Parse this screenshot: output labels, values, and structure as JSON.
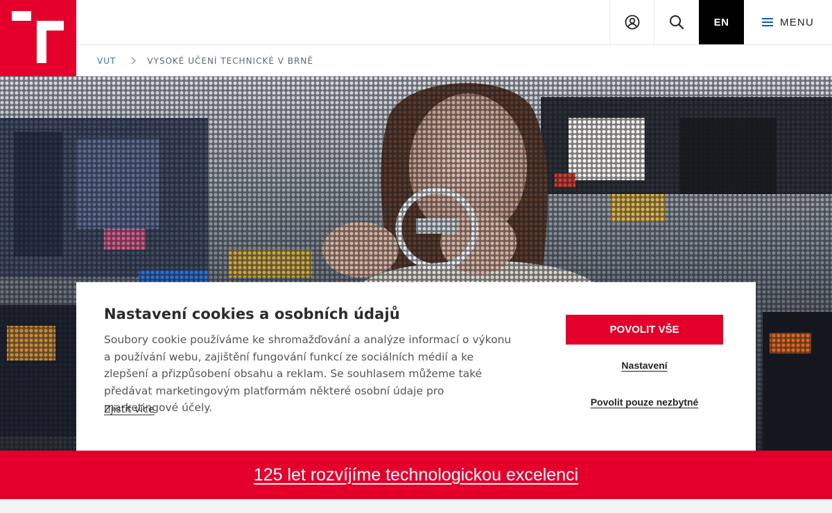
{
  "header": {
    "logo_icon": "vut-logo",
    "user_icon": "user-icon",
    "search_icon": "search-icon",
    "language_label": "EN",
    "menu_label": "MENU"
  },
  "breadcrumb": {
    "home": "VUT",
    "current": "VYSOKÉ UČENÍ TECHNICKÉ V BRNĚ"
  },
  "cookie_banner": {
    "title": "Nastavení cookies a osobních údajů",
    "text": "Soubory cookie používáme ke shromažďování a analýze informací o výkonu a používání webu, zajištění fungování funkcí ze sociálních médií a ke zlepšení a přizpůsobení obsahu a reklam. Se souhlasem můžeme také předávat marketingovým platformám některé osobní údaje pro marketingové účely.",
    "learn_more": "Zjistit více",
    "allow_all": "POVOLIT VŠE",
    "settings": "Nastavení",
    "allow_necessary": "Povolit pouze nezbytné"
  },
  "banner": {
    "text": "125 let rozvíjíme technologickou excelenci"
  },
  "colors": {
    "brand_red": "#e4002b",
    "link_blue": "#2a7ab7",
    "black": "#000000"
  }
}
